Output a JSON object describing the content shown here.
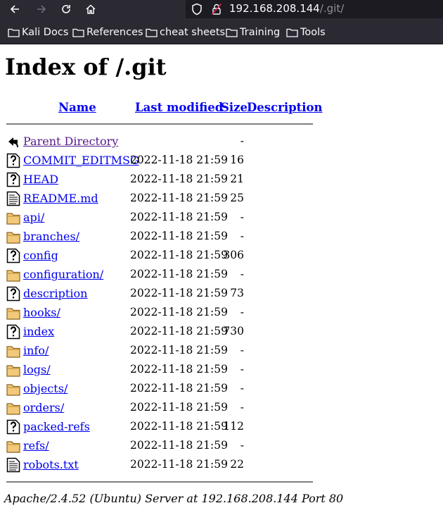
{
  "browser": {
    "url_host": "192.168.208.144",
    "url_path": "/.git/",
    "bookmarks": [
      "Kali Docs",
      "References",
      "cheat sheets",
      "Training",
      "Tools"
    ]
  },
  "page": {
    "title": "Index of /.git",
    "columns": {
      "name": "Name",
      "last_modified": "Last modified",
      "size": "Size",
      "description": "Description"
    },
    "parent": {
      "name": "Parent Directory",
      "size": "-"
    },
    "entries": [
      {
        "name": "COMMIT_EDITMSG",
        "date": "2022-11-18 21:59",
        "size": "16",
        "icon": "unknown-file-icon"
      },
      {
        "name": "HEAD",
        "date": "2022-11-18 21:59",
        "size": "21",
        "icon": "unknown-file-icon"
      },
      {
        "name": "README.md",
        "date": "2022-11-18 21:59",
        "size": "25",
        "icon": "text-file-icon"
      },
      {
        "name": "api/",
        "date": "2022-11-18 21:59",
        "size": "-",
        "icon": "folder-icon"
      },
      {
        "name": "branches/",
        "date": "2022-11-18 21:59",
        "size": "-",
        "icon": "folder-icon"
      },
      {
        "name": "config",
        "date": "2022-11-18 21:59",
        "size": "306",
        "icon": "unknown-file-icon"
      },
      {
        "name": "configuration/",
        "date": "2022-11-18 21:59",
        "size": "-",
        "icon": "folder-icon"
      },
      {
        "name": "description",
        "date": "2022-11-18 21:59",
        "size": "73",
        "icon": "unknown-file-icon"
      },
      {
        "name": "hooks/",
        "date": "2022-11-18 21:59",
        "size": "-",
        "icon": "folder-icon"
      },
      {
        "name": "index",
        "date": "2022-11-18 21:59",
        "size": "730",
        "icon": "unknown-file-icon"
      },
      {
        "name": "info/",
        "date": "2022-11-18 21:59",
        "size": "-",
        "icon": "folder-icon"
      },
      {
        "name": "logs/",
        "date": "2022-11-18 21:59",
        "size": "-",
        "icon": "folder-icon"
      },
      {
        "name": "objects/",
        "date": "2022-11-18 21:59",
        "size": "-",
        "icon": "folder-icon"
      },
      {
        "name": "orders/",
        "date": "2022-11-18 21:59",
        "size": "-",
        "icon": "folder-icon"
      },
      {
        "name": "packed-refs",
        "date": "2022-11-18 21:59",
        "size": "112",
        "icon": "unknown-file-icon"
      },
      {
        "name": "refs/",
        "date": "2022-11-18 21:59",
        "size": "-",
        "icon": "folder-icon"
      },
      {
        "name": "robots.txt",
        "date": "2022-11-18 21:59",
        "size": "22",
        "icon": "text-file-icon"
      }
    ],
    "footer": "Apache/2.4.52 (Ubuntu) Server at 192.168.208.144 Port 80"
  },
  "colors": {
    "link": "#0000ee",
    "visited": "#551a8b",
    "chrome": "#2b2a33",
    "urlbar": "#1c1b22"
  }
}
